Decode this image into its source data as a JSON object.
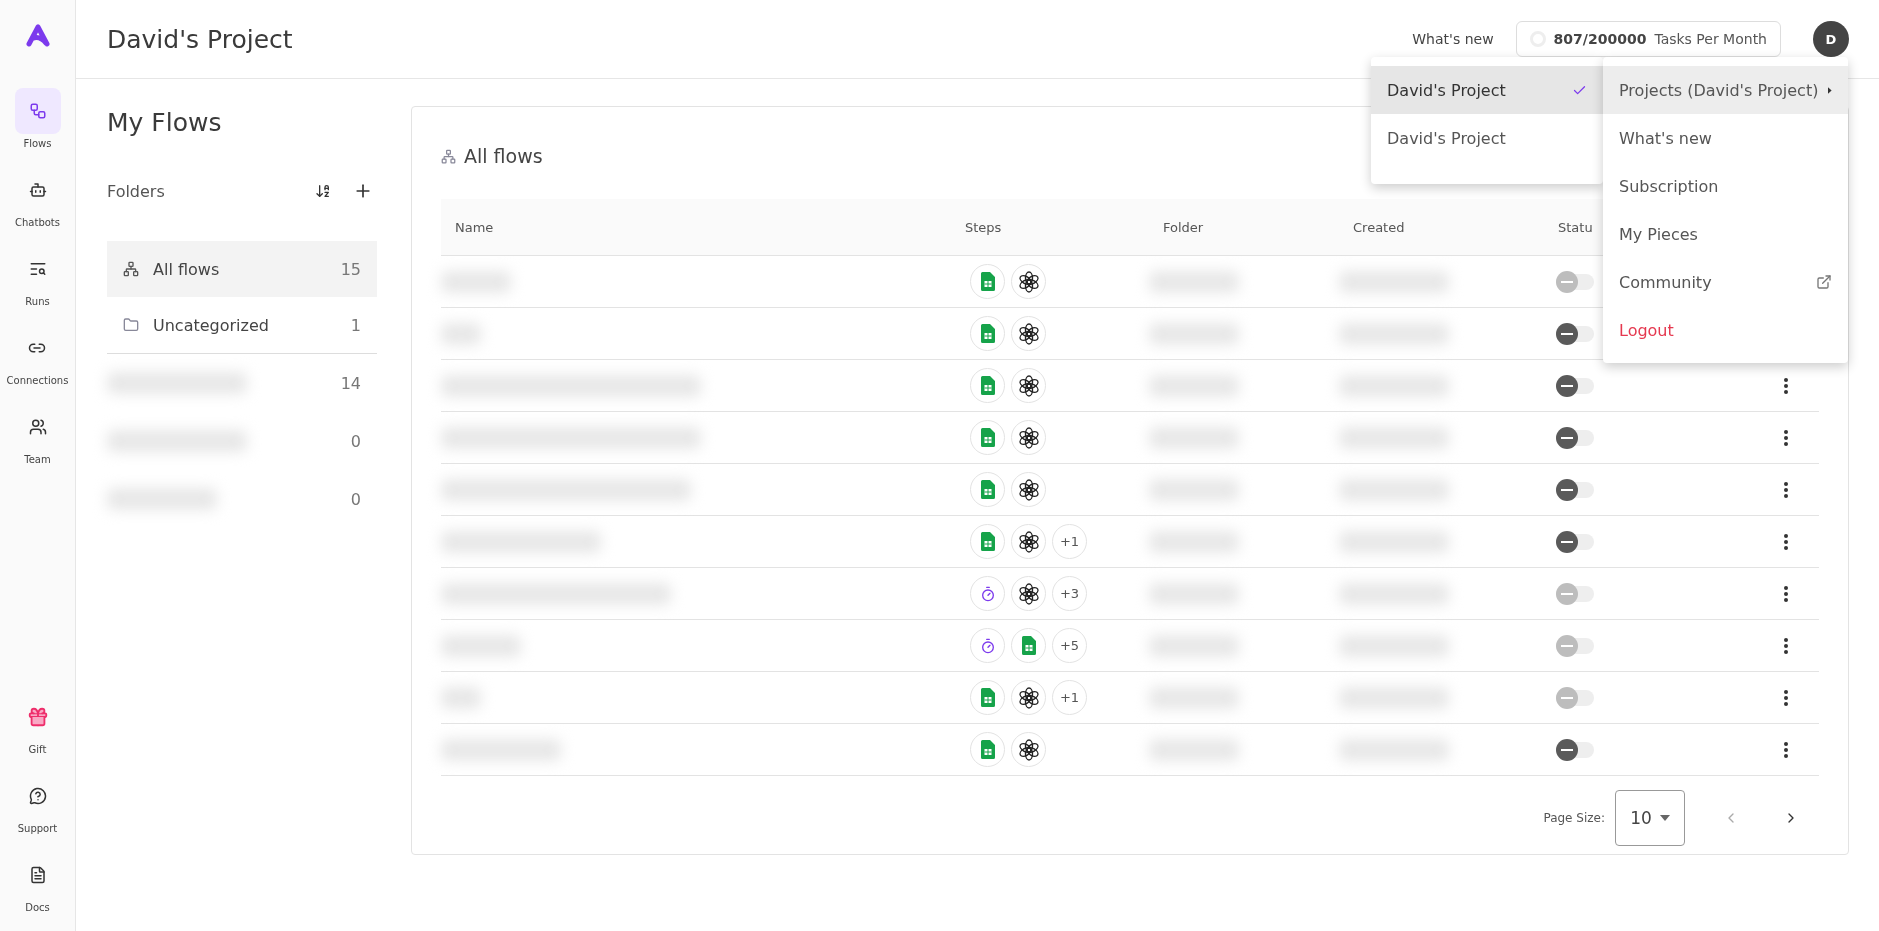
{
  "sidebar": {
    "items": [
      {
        "label": "Flows",
        "kind": "flows",
        "selected": true
      },
      {
        "label": "Chatbots",
        "kind": "bot",
        "selected": false
      },
      {
        "label": "Runs",
        "kind": "runs",
        "selected": false
      },
      {
        "label": "Connections",
        "kind": "link",
        "selected": false
      },
      {
        "label": "Team",
        "kind": "team",
        "selected": false
      }
    ],
    "bottom_items": [
      {
        "label": "Gift",
        "kind": "gift"
      },
      {
        "label": "Support",
        "kind": "support"
      },
      {
        "label": "Docs",
        "kind": "docs"
      }
    ]
  },
  "header": {
    "title": "David's Project",
    "whats_new": "What's new",
    "tasks_count": "807/200000",
    "tasks_label": "Tasks Per Month",
    "avatar": "D"
  },
  "page_title": "My Flows",
  "folders": {
    "title": "Folders",
    "items": [
      {
        "label": "All flows",
        "kind": "flows",
        "count": "15",
        "selected": true
      },
      {
        "label": "Uncategorized",
        "kind": "folder",
        "count": "1",
        "selected": false
      }
    ],
    "hidden_items": [
      {
        "count": "14"
      },
      {
        "count": "0"
      },
      {
        "count": "0"
      }
    ]
  },
  "table": {
    "title": "All flows",
    "columns": [
      "Name",
      "Steps",
      "Folder",
      "Created",
      "Statu"
    ],
    "rows": [
      {
        "steps": [
          {
            "kind": "sheets"
          },
          {
            "kind": "openai"
          }
        ],
        "disabled": true
      },
      {
        "steps": [
          {
            "kind": "sheets"
          },
          {
            "kind": "openai"
          }
        ],
        "disabled": false
      },
      {
        "steps": [
          {
            "kind": "sheets"
          },
          {
            "kind": "openai"
          }
        ],
        "disabled": false
      },
      {
        "steps": [
          {
            "kind": "sheets"
          },
          {
            "kind": "openai"
          }
        ],
        "disabled": false
      },
      {
        "steps": [
          {
            "kind": "sheets"
          },
          {
            "kind": "openai"
          }
        ],
        "disabled": false
      },
      {
        "steps": [
          {
            "kind": "sheets"
          },
          {
            "kind": "openai"
          }
        ],
        "more": "+1",
        "disabled": false
      },
      {
        "steps": [
          {
            "kind": "schedule"
          },
          {
            "kind": "openai"
          }
        ],
        "more": "+3",
        "disabled": true
      },
      {
        "steps": [
          {
            "kind": "schedule"
          },
          {
            "kind": "sheets"
          }
        ],
        "more": "+5",
        "disabled": true
      },
      {
        "steps": [
          {
            "kind": "sheets"
          },
          {
            "kind": "openai"
          }
        ],
        "more": "+1",
        "disabled": true
      },
      {
        "steps": [
          {
            "kind": "sheets"
          },
          {
            "kind": "openai"
          }
        ],
        "disabled": false
      }
    ]
  },
  "pagination": {
    "label": "Page Size:",
    "value": "10"
  },
  "project_menu": {
    "items": [
      {
        "label": "David's Project",
        "selected": true
      },
      {
        "label": "David's Project",
        "selected": false
      }
    ]
  },
  "user_menu": {
    "items": [
      {
        "label": "Projects (David's Project)",
        "kind": "submenu",
        "highlighted": true
      },
      {
        "label": "What's new",
        "kind": "plain",
        "highlighted": false
      },
      {
        "label": "Subscription",
        "kind": "plain",
        "highlighted": false
      },
      {
        "label": "My Pieces",
        "kind": "plain",
        "highlighted": false
      },
      {
        "label": "Community",
        "kind": "external",
        "highlighted": false
      },
      {
        "label": "Logout",
        "kind": "danger",
        "highlighted": false
      }
    ]
  }
}
